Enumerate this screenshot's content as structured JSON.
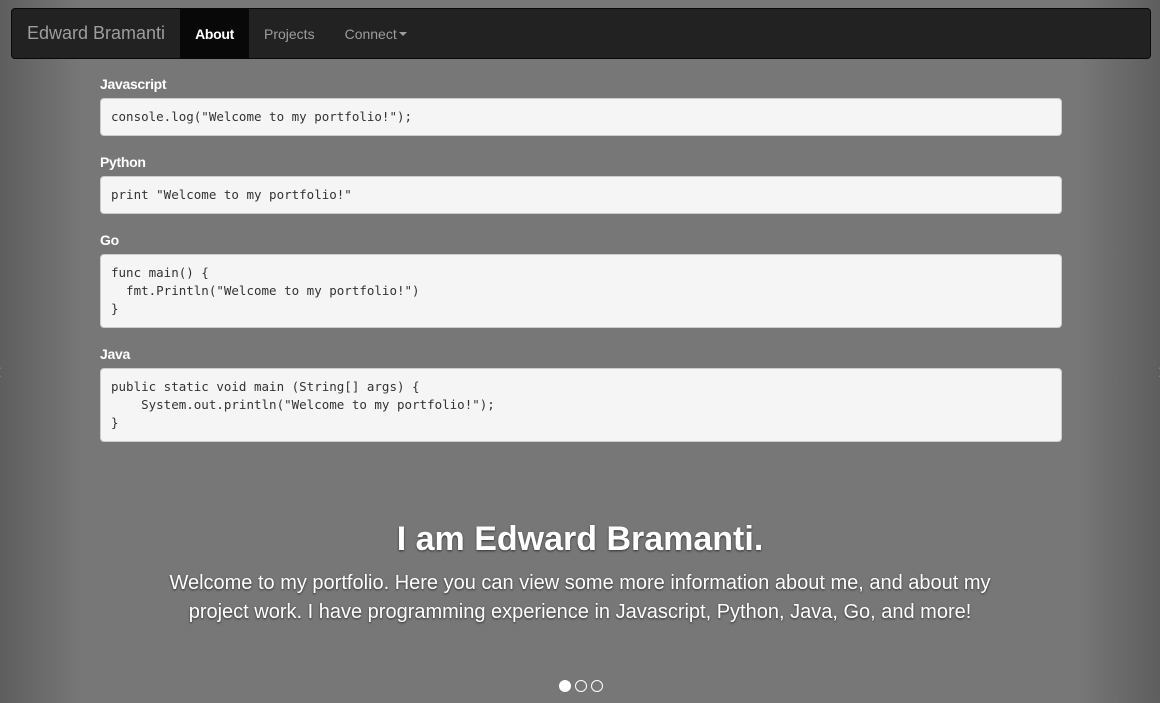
{
  "navbar": {
    "brand": "Edward Bramanti",
    "items": [
      {
        "label": "About"
      },
      {
        "label": "Projects"
      },
      {
        "label": "Connect"
      }
    ]
  },
  "snippets": [
    {
      "language": "Javascript",
      "code": "console.log(\"Welcome to my portfolio!\");"
    },
    {
      "language": "Python",
      "code": "print \"Welcome to my portfolio!\""
    },
    {
      "language": "Go",
      "code": "func main() {\n  fmt.Println(\"Welcome to my portfolio!\")\n}"
    },
    {
      "language": "Java",
      "code": "public static void main (String[] args) {\n    System.out.println(\"Welcome to my portfolio!\");\n}"
    }
  ],
  "hero": {
    "title": "I am Edward Bramanti.",
    "text": "Welcome to my portfolio. Here you can view some more information about me, and about my project work. I have programming experience in Javascript, Python, Java, Go, and more!"
  },
  "carousel": {
    "slides": 3,
    "active": 1,
    "prev_icon": "chevron-left-icon",
    "next_icon": "chevron-right-icon"
  }
}
